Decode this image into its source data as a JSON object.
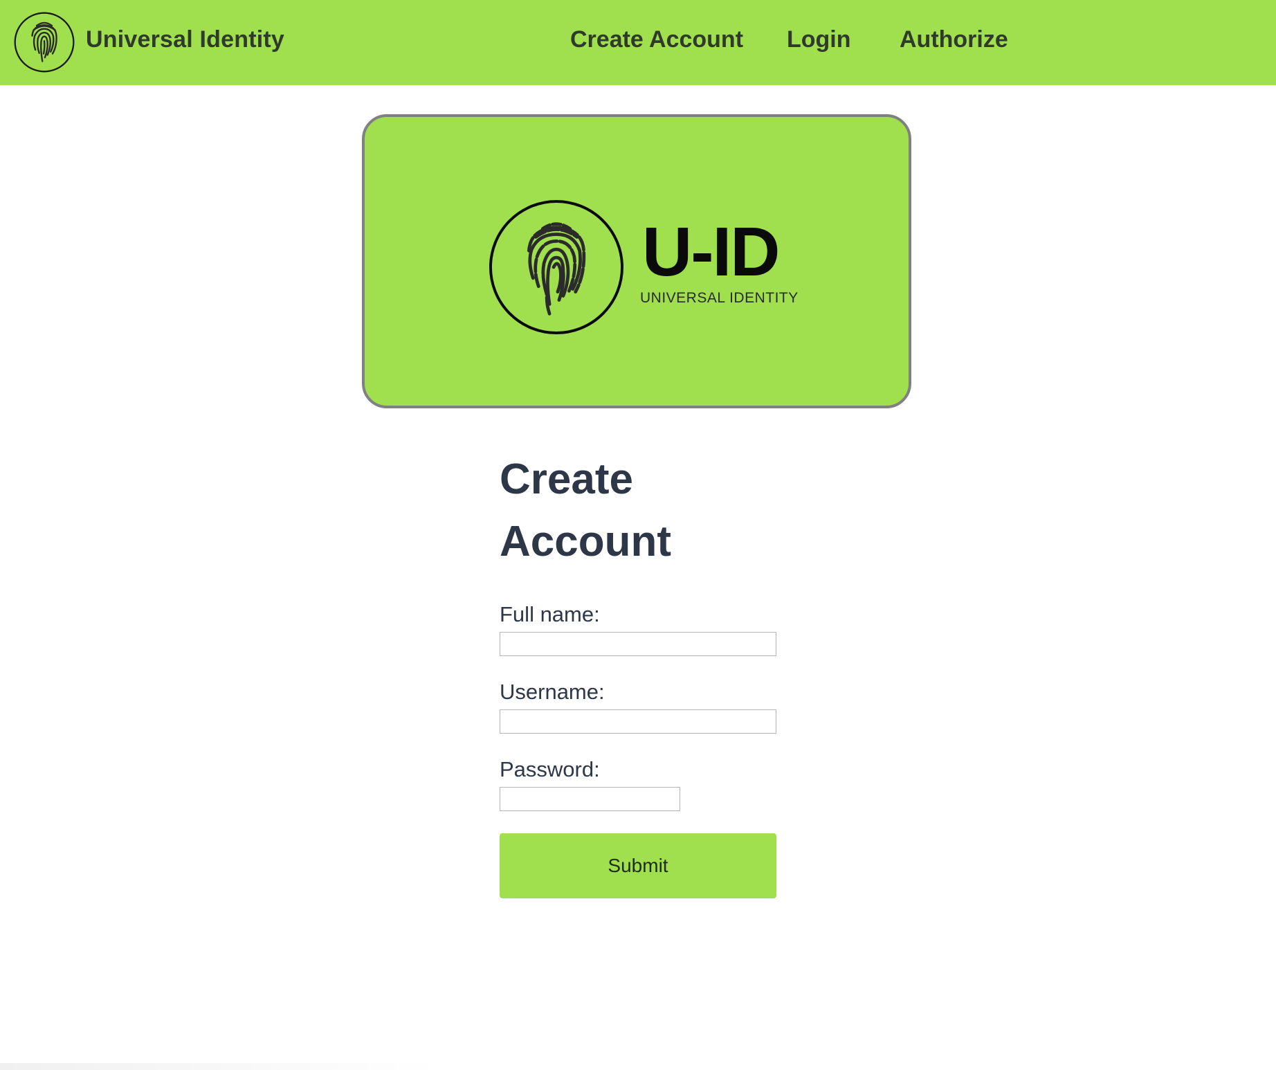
{
  "nav": {
    "brand": "Universal Identity",
    "links": [
      {
        "label": "Create Account"
      },
      {
        "label": "Login"
      },
      {
        "label": "Authorize"
      }
    ]
  },
  "banner": {
    "title": "U-ID",
    "subtitle": "UNIVERSAL IDENTITY",
    "logo_icon": "fingerprint-icon"
  },
  "form": {
    "heading": "Create Account",
    "fields": [
      {
        "label": "Full name:",
        "value": "",
        "type": "text"
      },
      {
        "label": "Username:",
        "value": "",
        "type": "text"
      },
      {
        "label": "Password:",
        "value": "",
        "type": "password"
      }
    ],
    "submit_label": "Submit"
  },
  "colors": {
    "brand_green": "#a0e04f",
    "banner_border": "#808080",
    "heading_text": "#2d3748"
  }
}
